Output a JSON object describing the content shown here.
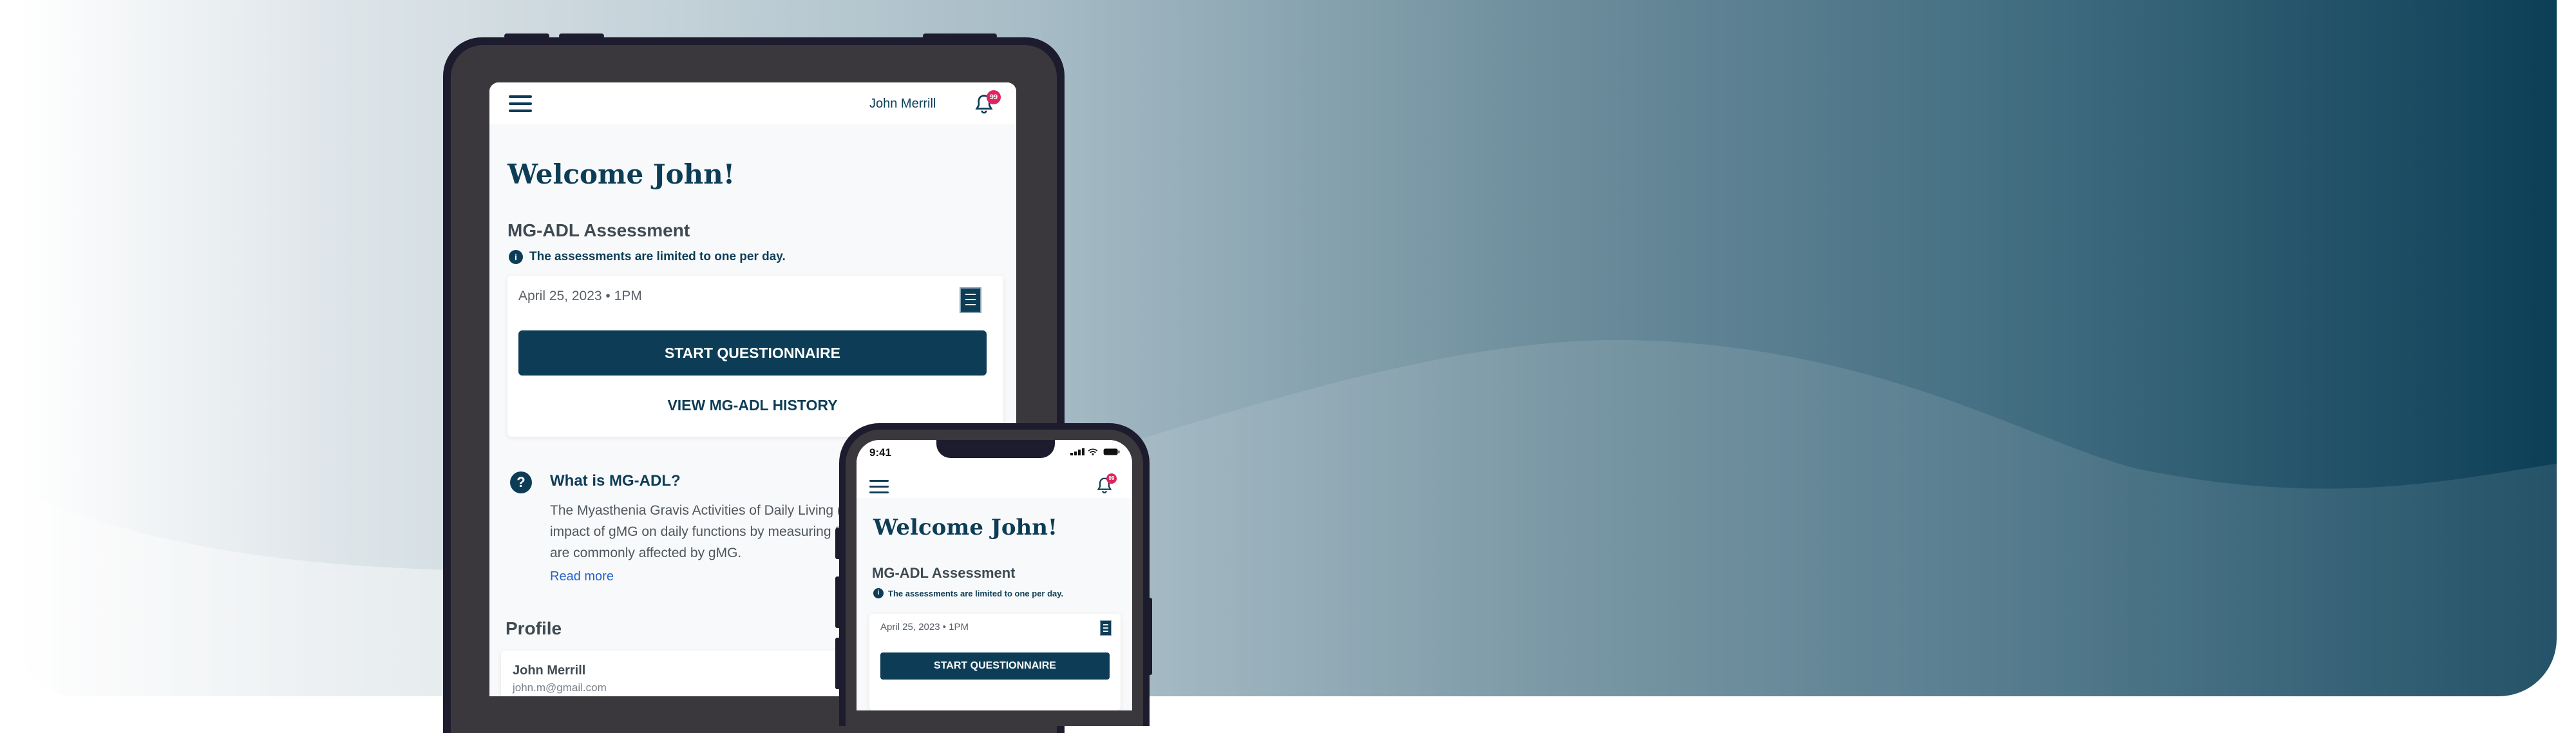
{
  "tablet": {
    "user_name": "John Merrill",
    "notification_count": "99",
    "welcome": "Welcome John!",
    "assessment_title": "MG-ADL Assessment",
    "notice": "The assessments are limited to one per day.",
    "date": "April 25, 2023 • 1PM",
    "start_button": "START QUESTIONNAIRE",
    "history_link": "VIEW MG-ADL HISTORY",
    "info_title": "What is MG-ADL?",
    "info_body": "The Myasthenia Gravis Activities of Daily Living (MG-ADL) assesses the impact of gMG on daily functions by measuring 8 signs or symptoms that are commonly affected by gMG.",
    "read_more": "Read more",
    "profile_title": "Profile",
    "profile_name": "John Merrill",
    "profile_email": "john.m@gmail.com"
  },
  "phone": {
    "time": "9:41",
    "notification_count": "99",
    "welcome": "Welcome John!",
    "assessment_title": "MG-ADL Assessment",
    "notice": "The assessments are limited to one per day.",
    "date": "April 25, 2023 • 1PM",
    "start_button": "START QUESTIONNAIRE"
  },
  "colors": {
    "primary": "#0d3d56",
    "badge": "#e0245e",
    "link": "#2563c8"
  },
  "icons": [
    "menu-icon",
    "bell-icon",
    "info-icon",
    "questionnaire-icon",
    "question-icon",
    "signal-icon",
    "wifi-icon",
    "battery-icon"
  ]
}
